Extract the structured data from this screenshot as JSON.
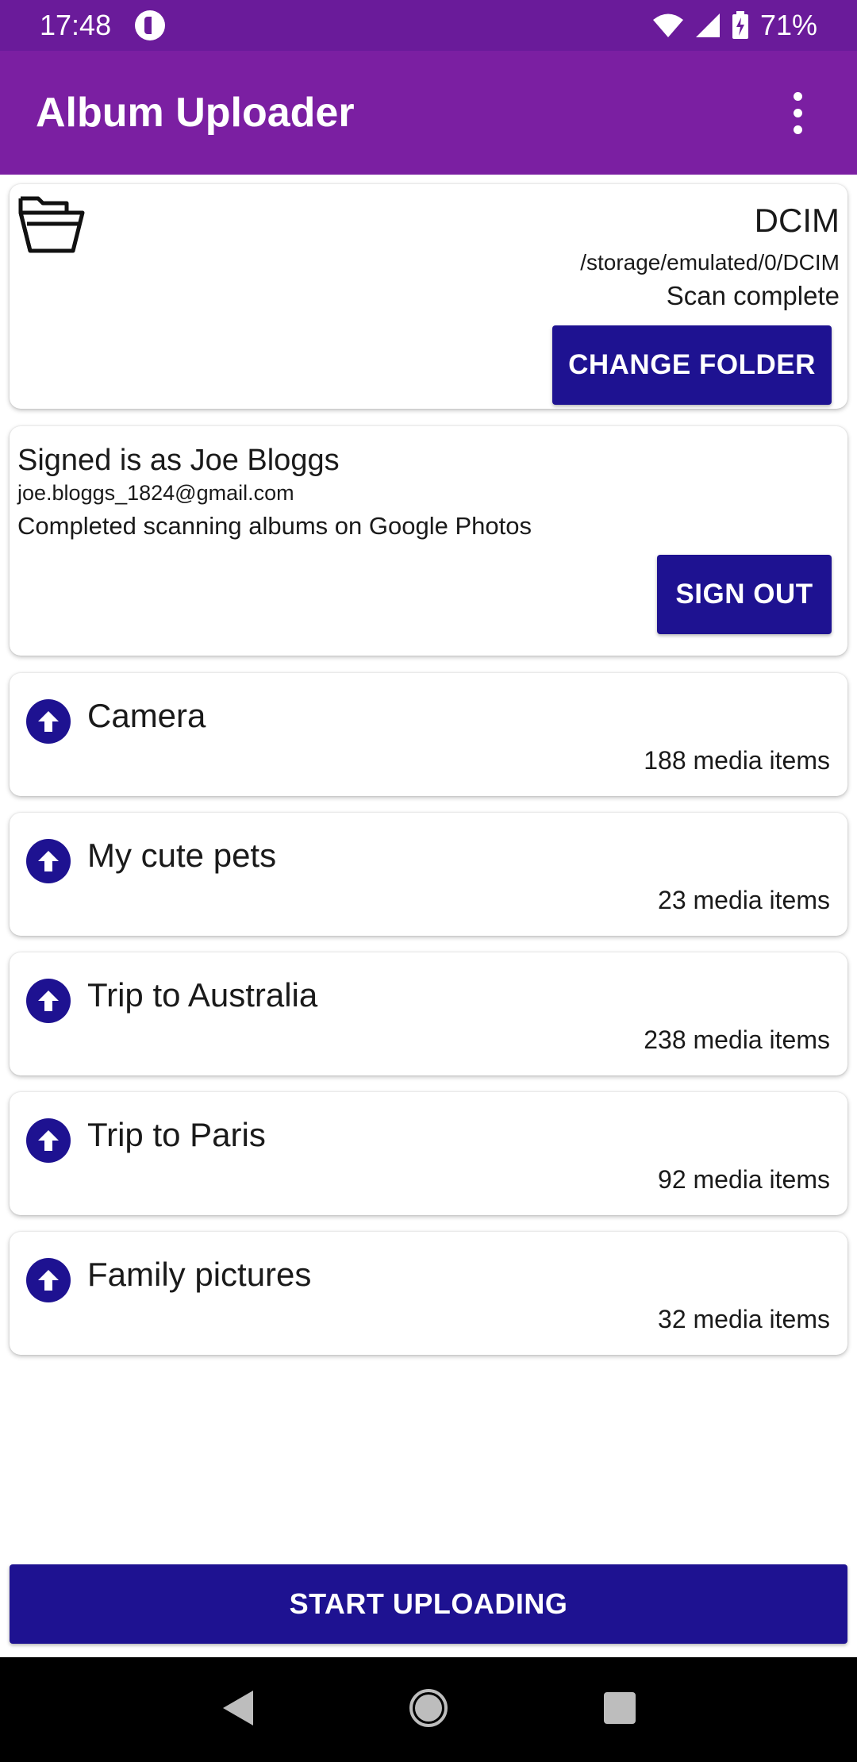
{
  "status_bar": {
    "time": "17:48",
    "battery": "71%",
    "icons": [
      "app-notification-icon",
      "wifi-icon",
      "signal-icon",
      "battery-charging-icon"
    ]
  },
  "app_bar": {
    "title": "Album Uploader",
    "menu_icon": "more-vert-icon"
  },
  "folder": {
    "icon": "open-folder-icon",
    "name": "DCIM",
    "path": "/storage/emulated/0/DCIM",
    "status": "Scan complete",
    "button_label": "CHANGE FOLDER"
  },
  "account": {
    "signed_in": "Signed is as Joe Bloggs",
    "email": "joe.bloggs_1824@gmail.com",
    "status": "Completed scanning albums on Google Photos",
    "button_label": "SIGN OUT"
  },
  "albums": [
    {
      "name": "Camera",
      "count": "188 media items",
      "icon": "upload-icon"
    },
    {
      "name": "My cute pets",
      "count": "23 media items",
      "icon": "upload-icon"
    },
    {
      "name": "Trip to Australia",
      "count": "238 media items",
      "icon": "upload-icon"
    },
    {
      "name": "Trip to Paris",
      "count": "92 media items",
      "icon": "upload-icon"
    },
    {
      "name": "Family pictures",
      "count": "32 media items",
      "icon": "upload-icon"
    }
  ],
  "start_button_label": "START UPLOADING",
  "nav_bar": {
    "icons": [
      "back-icon",
      "home-icon",
      "recents-icon"
    ]
  },
  "colors": {
    "status_bar": "#6a1b9a",
    "app_bar": "#7b1fa2",
    "accent": "#1e1291"
  }
}
